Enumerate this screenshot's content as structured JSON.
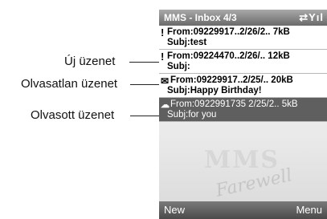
{
  "callouts": {
    "new_message": "Új üzenet",
    "unread_message": "Olvasatlan üzenet",
    "read_message": "Olvasott üzenet"
  },
  "titlebar": {
    "title": "MMS - Inbox 4/3",
    "status_icons": "⇄Yıl"
  },
  "messages": [
    {
      "icon": "!",
      "line1": "From:09229917..2/26/2.. 7kB",
      "line2": "Subj:test"
    },
    {
      "icon": "!",
      "line1": "From:09224470..2/26/.. 12kB",
      "line2": "Subj:"
    },
    {
      "icon": "✉",
      "line1": "From:09229917..2/25/.. 20kB",
      "line2": "Subj:Happy Birthday!"
    },
    {
      "icon": "☁",
      "line1": "From:0922991735 2/25/2.. 5kB",
      "line2": "Subj:for you"
    }
  ],
  "watermark": {
    "line1": "MMS",
    "line2": "Farewell"
  },
  "softkeys": {
    "left": "New",
    "right": "Menu"
  }
}
